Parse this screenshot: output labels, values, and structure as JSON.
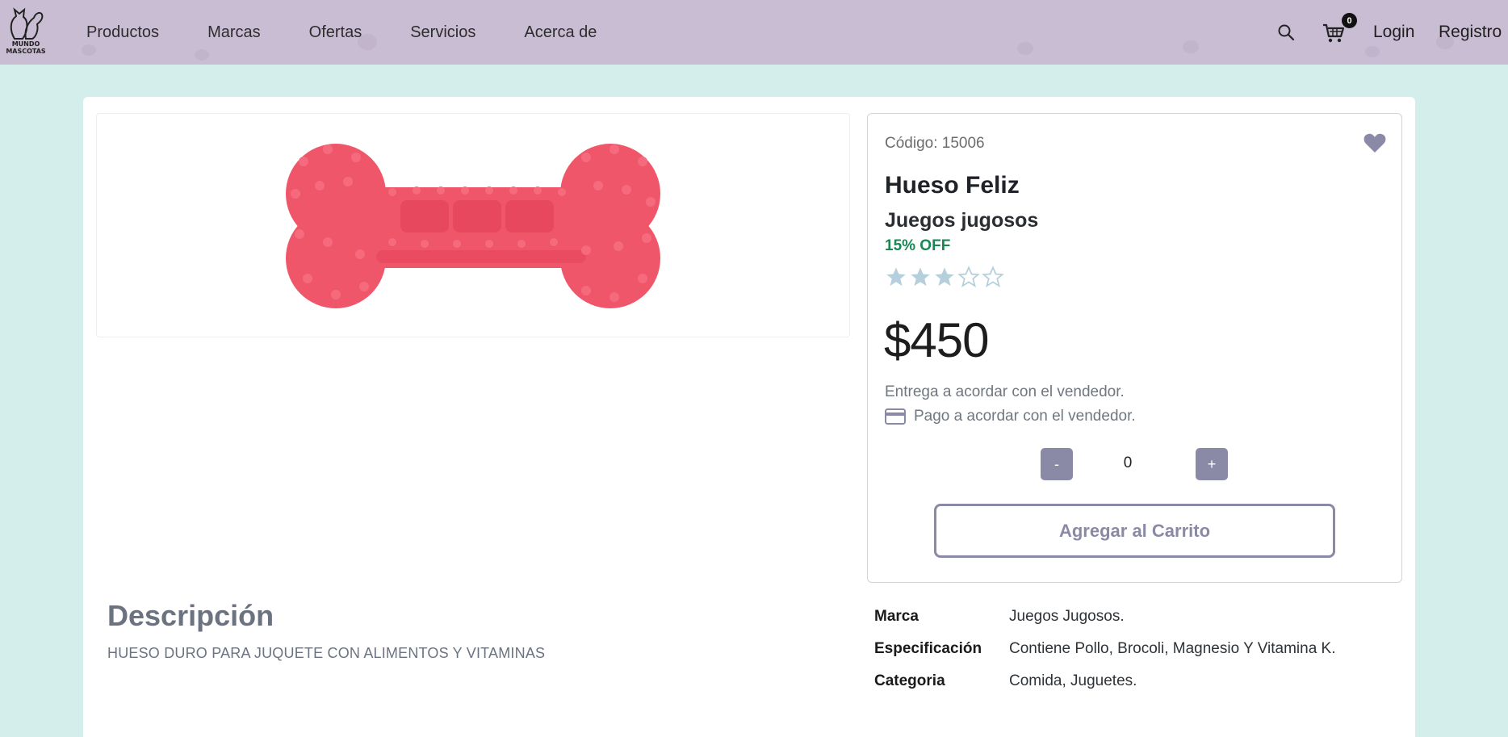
{
  "nav": {
    "logo_line1": "MUNDO",
    "logo_line2": "MASCOTAS",
    "links": [
      "Productos",
      "Marcas",
      "Ofertas",
      "Servicios",
      "Acerca de"
    ],
    "cart_count": "0",
    "login": "Login",
    "register": "Registro"
  },
  "product": {
    "code": "Código: 15006",
    "title": "Hueso Feliz",
    "brand_title": "Juegos jugosos",
    "discount": "15% OFF",
    "rating": 3,
    "rating_max": 5,
    "price": "$450",
    "delivery": "Entrega a acordar con el vendedor.",
    "payment": "Pago a acordar con el vendedor.",
    "quantity": "0",
    "minus_label": "-",
    "plus_label": "+",
    "add_to_cart": "Agregar al Carrito"
  },
  "description": {
    "title": "Descripción",
    "text": "HUESO DURO PARA JUQUETE CON ALIMENTOS Y VITAMINAS"
  },
  "specs": [
    {
      "label": "Marca",
      "value": "Juegos Jugosos."
    },
    {
      "label": "Especificación",
      "value": "Contiene Pollo, Brocoli, Magnesio Y Vitamina K."
    },
    {
      "label": "Categoria",
      "value": "Comida, Juguetes."
    }
  ],
  "colors": {
    "navbar": "#c9bdd3",
    "background": "#d4eeeb",
    "accent": "#8a8aa6",
    "discount": "#198754",
    "star": "#b5d0dc",
    "product": "#f0566a"
  },
  "icons": [
    "search-icon",
    "cart-icon",
    "heart-icon",
    "star-icon",
    "credit-card-icon"
  ]
}
